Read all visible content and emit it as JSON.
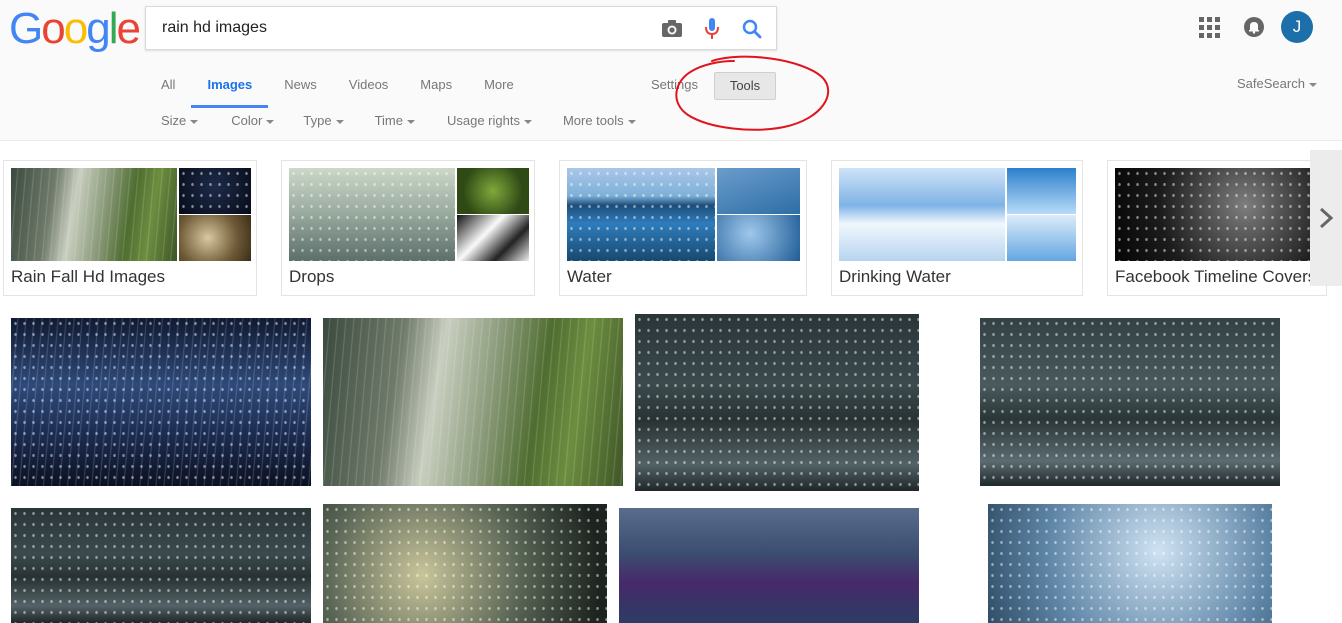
{
  "logo": {
    "letters": [
      "G",
      "o",
      "o",
      "g",
      "l",
      "e"
    ],
    "colors": [
      "#4285f4",
      "#ea4335",
      "#fbbc05",
      "#4285f4",
      "#34a853",
      "#ea4335"
    ]
  },
  "search": {
    "value": "rain hd images"
  },
  "header": {
    "avatar_initial": "J"
  },
  "tabs": [
    {
      "label": "All",
      "active": false
    },
    {
      "label": "Images",
      "active": true
    },
    {
      "label": "News",
      "active": false
    },
    {
      "label": "Videos",
      "active": false
    },
    {
      "label": "Maps",
      "active": false
    },
    {
      "label": "More",
      "active": false
    }
  ],
  "toolbar": {
    "settings_label": "Settings",
    "tools_label": "Tools",
    "safesearch_label": "SafeSearch"
  },
  "filters": [
    "Size",
    "Color",
    "Type",
    "Time",
    "Usage rights",
    "More tools"
  ],
  "annotation": {
    "color": "#e0141e",
    "shape": "hand-drawn circle around Tools"
  },
  "related": [
    {
      "label": "Rain Fall Hd Images"
    },
    {
      "label": "Drops"
    },
    {
      "label": "Water"
    },
    {
      "label": "Drinking Water"
    },
    {
      "label": "Facebook Timeline Covers"
    }
  ],
  "results_count": 8,
  "colors": {
    "accent": "#4285f4",
    "tab_active_text": "#1a73e8",
    "avatar_bg": "#1d6fa9"
  }
}
